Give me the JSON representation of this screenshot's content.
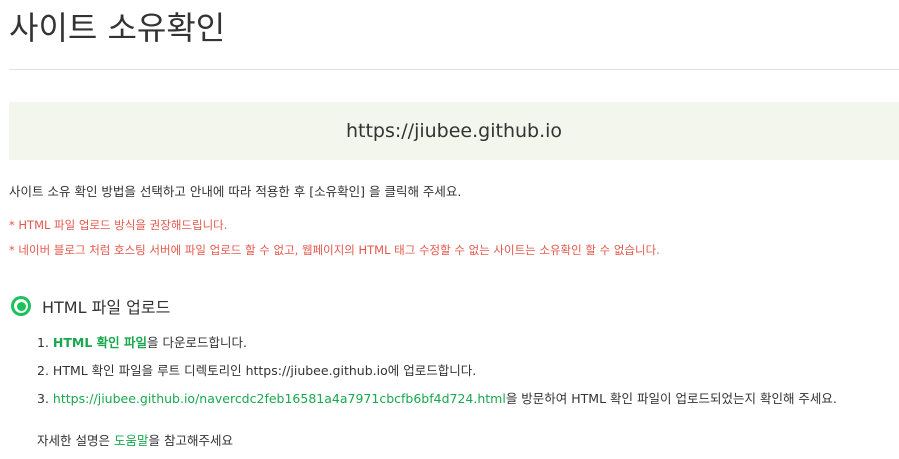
{
  "page": {
    "title": "사이트 소유확인",
    "site_url": "https://jiubee.github.io"
  },
  "instruction": "사이트 소유 확인 방법을 선택하고 안내에 따라 적용한 후 [소유확인] 을 클릭해 주세요.",
  "notices": [
    "* HTML 파일 업로드 방식을 권장해드립니다.",
    "* 네이버 블로그 처럼 호스팅 서버에 파일 업로드 할 수 없고, 웹페이지의 HTML 태그 수정할 수 없는 사이트는 소유확인 할 수 없습니다."
  ],
  "method": {
    "label": "HTML 파일 업로드",
    "selected": true
  },
  "steps": [
    {
      "number": "1.",
      "link": "HTML 확인 파일",
      "text": "을 다운로드합니다."
    },
    {
      "number": "2.",
      "text": "HTML 확인 파일을 루트 디렉토리인 https://jiubee.github.io에 업로드합니다."
    },
    {
      "number": "3.",
      "link": "https://jiubee.github.io/navercdc2feb16581a4a7971cbcfb6bf4d724.html",
      "text": "을 방문하여 HTML 확인 파일이 업로드되었는지 확인해 주세요."
    }
  ],
  "help": {
    "prefix": "자세한 설명은 ",
    "link": "도움말",
    "suffix": "을 참고해주세요"
  },
  "colors": {
    "accent_green": "#19c35a",
    "link_green": "#19a84e",
    "notice_red": "#e4584c",
    "banner_bg": "#f2f6ec"
  }
}
